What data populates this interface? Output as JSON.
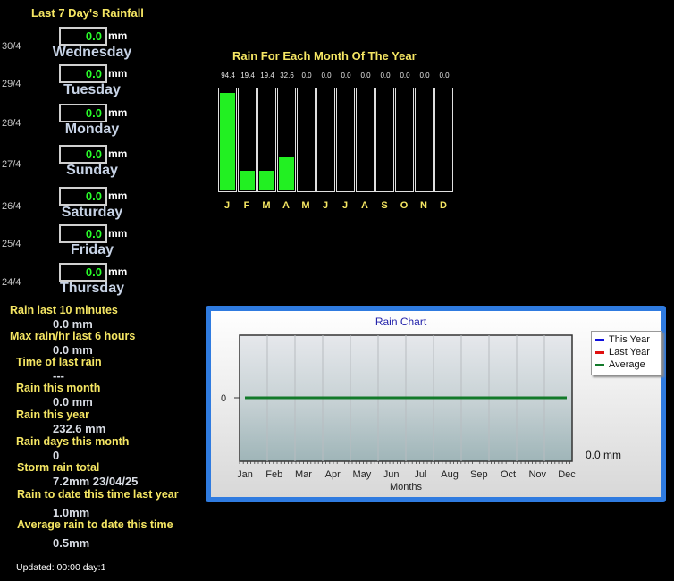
{
  "weekly": {
    "title": "Last 7 Day's Rainfall",
    "unit": "mm",
    "days": [
      {
        "date": "30/4",
        "name": "Wednesday",
        "value": "0.0"
      },
      {
        "date": "29/4",
        "name": "Tuesday",
        "value": "0.0"
      },
      {
        "date": "28/4",
        "name": "Monday",
        "value": "0.0"
      },
      {
        "date": "27/4",
        "name": "Sunday",
        "value": "0.0"
      },
      {
        "date": "26/4",
        "name": "Saturday",
        "value": "0.0"
      },
      {
        "date": "25/4",
        "name": "Friday",
        "value": "0.0"
      },
      {
        "date": "24/4",
        "name": "Thursday",
        "value": "0.0"
      }
    ]
  },
  "stats": [
    {
      "label": "Rain last 10 minutes",
      "value": "0.0 mm"
    },
    {
      "label": "Max rain/hr last 6 hours",
      "value": "0.0 mm"
    },
    {
      "label": "Time of last rain",
      "value": "---"
    },
    {
      "label": "Rain this month",
      "value": "0.0 mm"
    },
    {
      "label": "Rain this year",
      "value": "232.6 mm"
    },
    {
      "label": "Rain days this month",
      "value": "0"
    },
    {
      "label": "Storm rain total",
      "value": "7.2mm 23/04/25"
    },
    {
      "label": "Rain to date this time last year",
      "value": "1.0mm"
    },
    {
      "label": "Average rain to date this time",
      "value": "0.5mm"
    }
  ],
  "updated": "Updated: 00:00 day:1",
  "monthly": {
    "title": "Rain For Each Month Of The Year",
    "labels": [
      "94.4",
      "19.4",
      "19.4",
      "32.6",
      "0.0",
      "0.0",
      "0.0",
      "0.0",
      "0.0",
      "0.0",
      "0.0",
      "0.0"
    ],
    "letters": [
      "J",
      "F",
      "M",
      "A",
      "M",
      "J",
      "J",
      "A",
      "S",
      "O",
      "N",
      "D"
    ]
  },
  "chart_data": [
    {
      "type": "bar",
      "title": "Rain For Each Month Of The Year",
      "categories": [
        "J",
        "F",
        "M",
        "A",
        "M",
        "J",
        "J",
        "A",
        "S",
        "O",
        "N",
        "D"
      ],
      "values": [
        94.4,
        19.4,
        19.4,
        32.6,
        0.0,
        0.0,
        0.0,
        0.0,
        0.0,
        0.0,
        0.0,
        0.0
      ],
      "ylim": [
        0,
        100
      ],
      "bar_color": "#22f022"
    },
    {
      "type": "line",
      "title": "Rain Chart",
      "xlabel": "Months",
      "ylabel": "",
      "categories": [
        "Jan",
        "Feb",
        "Mar",
        "Apr",
        "May",
        "Jun",
        "Jul",
        "Aug",
        "Sep",
        "Oct",
        "Nov",
        "Dec"
      ],
      "yticks": [
        "0"
      ],
      "series": [
        {
          "name": "This Year",
          "color": "#1010dd",
          "values": [
            0,
            0,
            0,
            0,
            0,
            0,
            0,
            0,
            0,
            0,
            0,
            0
          ]
        },
        {
          "name": "Last Year",
          "color": "#e01010",
          "values": [
            0,
            0,
            0,
            0,
            0,
            0,
            0,
            0,
            0,
            0,
            0,
            0
          ]
        },
        {
          "name": "Average",
          "color": "#127a2a",
          "values": [
            0,
            0,
            0,
            0,
            0,
            0,
            0,
            0,
            0,
            0,
            0,
            0
          ]
        }
      ],
      "legend": "top-right",
      "current_value": "0.0 mm",
      "grid": true
    }
  ]
}
